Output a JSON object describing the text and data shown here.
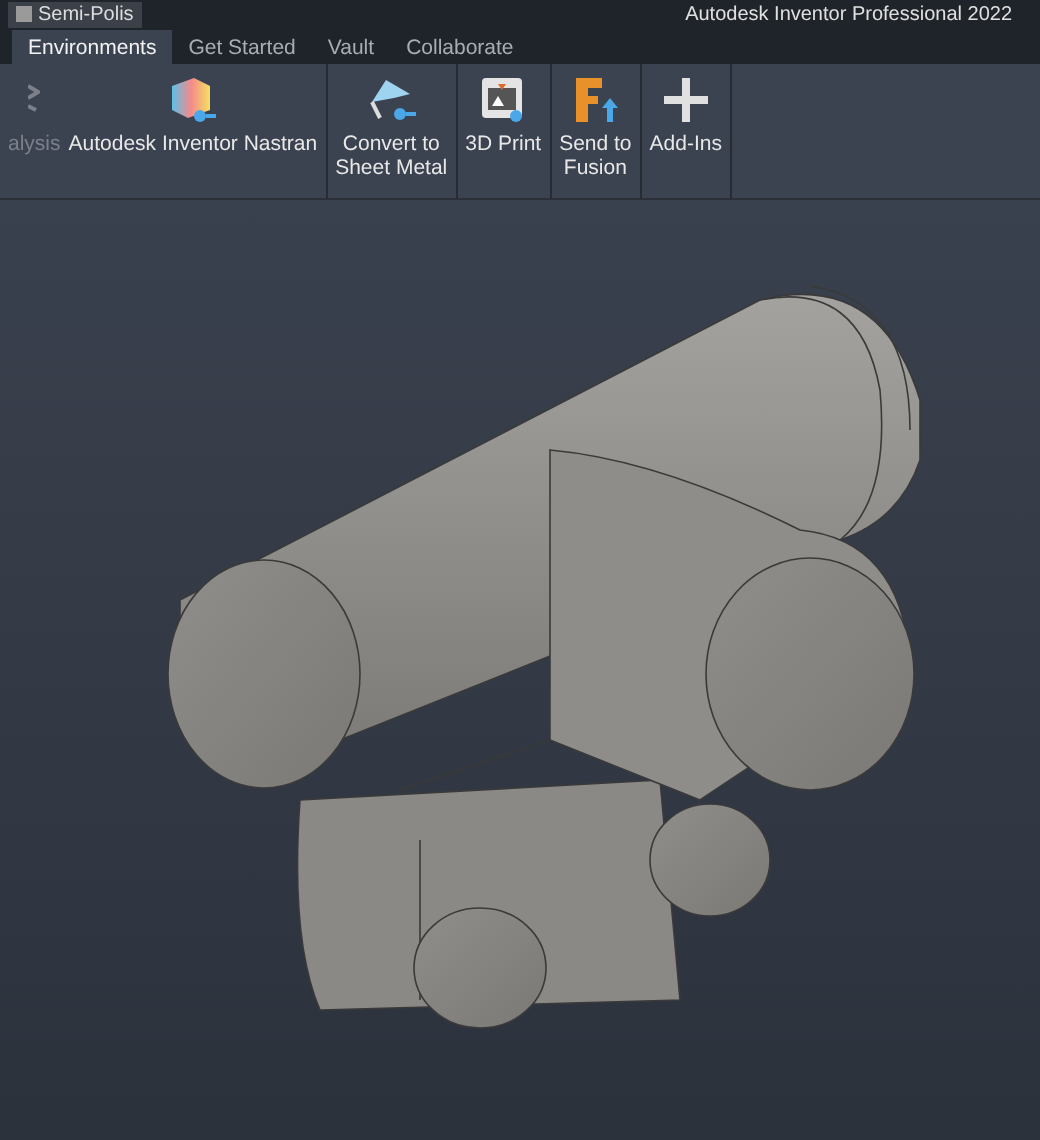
{
  "title_bar": {
    "material": "Semi-Polis",
    "app_title": "Autodesk Inventor Professional 2022"
  },
  "tabs": [
    {
      "label": "Environments",
      "selected": true
    },
    {
      "label": "Get Started",
      "selected": false
    },
    {
      "label": "Vault",
      "selected": false
    },
    {
      "label": "Collaborate",
      "selected": false
    }
  ],
  "ribbon": {
    "panels": [
      {
        "buttons": [
          {
            "label": "alysis",
            "disabled": true
          },
          {
            "label": "Autodesk Inventor Nastran",
            "disabled": false
          }
        ]
      },
      {
        "buttons": [
          {
            "label": "Convert to\nSheet Metal",
            "disabled": false
          }
        ]
      },
      {
        "buttons": [
          {
            "label": "3D Print",
            "disabled": false
          }
        ]
      },
      {
        "buttons": [
          {
            "label": "Send to\nFusion",
            "disabled": false
          }
        ]
      },
      {
        "buttons": [
          {
            "label": "Add-Ins",
            "disabled": false
          }
        ]
      }
    ]
  }
}
